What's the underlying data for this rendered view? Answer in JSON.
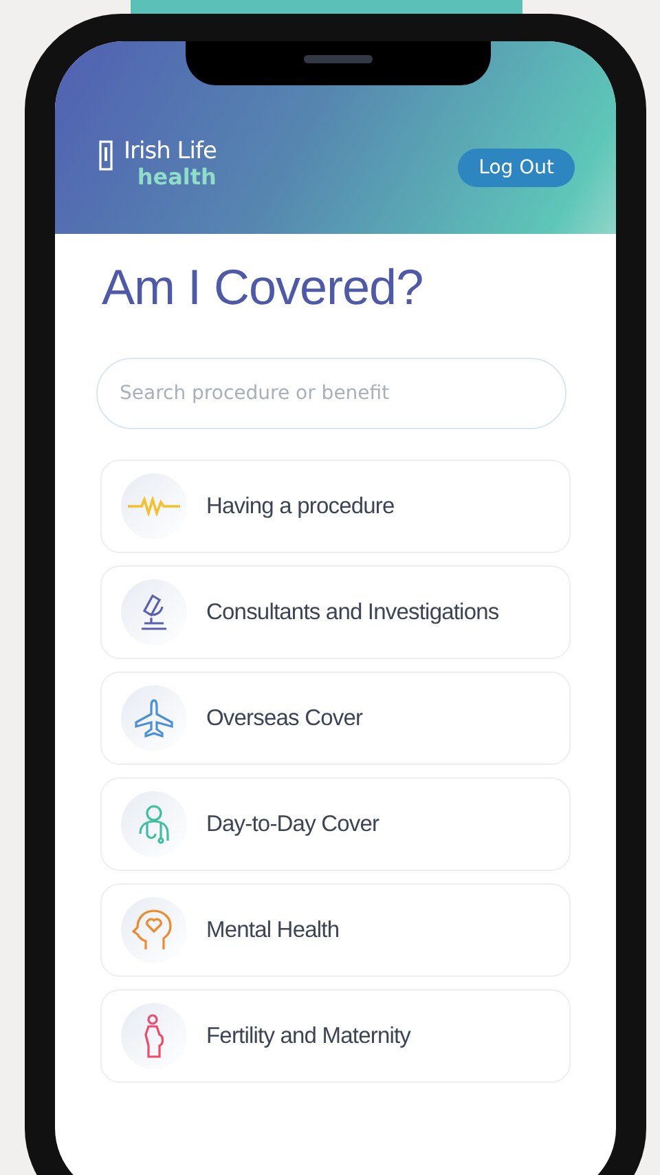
{
  "header": {
    "brand": "Irish Life",
    "sub_brand": "health",
    "logout_button": "Log Out"
  },
  "title": "Am I Covered?",
  "search": {
    "placeholder": "Search procedure or benefit"
  },
  "categories": [
    {
      "label": "Having a procedure",
      "kind": "pulse",
      "color": "#f5c02a"
    },
    {
      "label": "Consultants and Investigations",
      "kind": "microscope",
      "color": "#5a5fb0"
    },
    {
      "label": "Overseas Cover",
      "kind": "plane",
      "color": "#4a90d9"
    },
    {
      "label": "Day-to-Day Cover",
      "kind": "doctor",
      "color": "#3dbfa0"
    },
    {
      "label": "Mental Health",
      "kind": "head",
      "color": "#ef8a2a"
    },
    {
      "label": "Fertility and Maternity",
      "kind": "pregnant",
      "color": "#ee4b6a"
    }
  ]
}
